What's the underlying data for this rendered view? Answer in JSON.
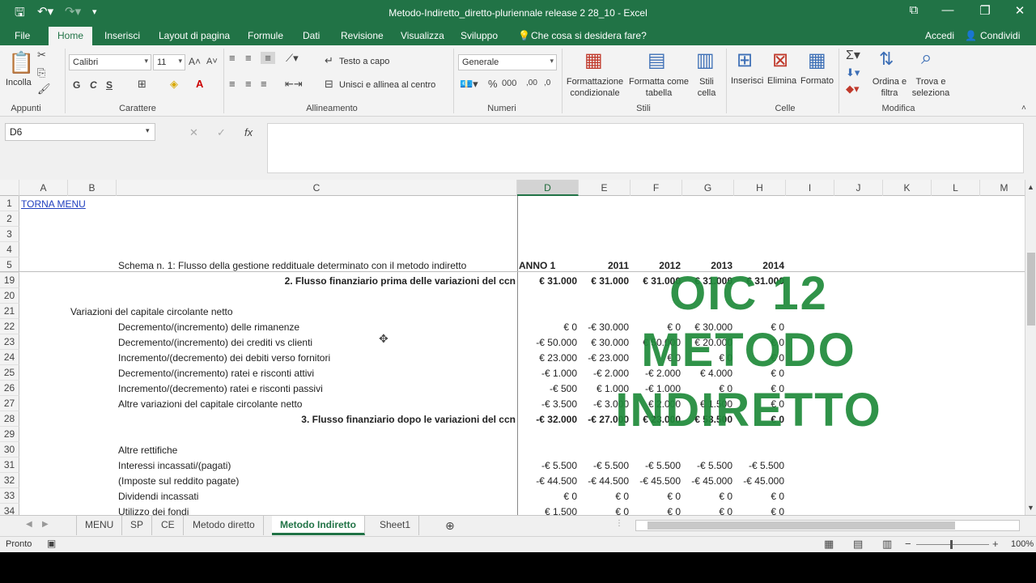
{
  "window": {
    "title": "Metodo-Indiretto_diretto-pluriennale release 2 28_10 - Excel"
  },
  "ribbon_tabs": [
    "File",
    "Home",
    "Inserisci",
    "Layout di pagina",
    "Formule",
    "Dati",
    "Revisione",
    "Visualizza",
    "Sviluppo",
    "Che cosa si desidera fare?"
  ],
  "account": {
    "signin": "Accedi",
    "share": "Condividi"
  },
  "ribbon": {
    "paste": "Incolla",
    "font_name": "Calibri",
    "font_size": "11",
    "bold": "G",
    "italic": "C",
    "underline": "S",
    "wrap": "Testo a capo",
    "merge": "Unisci e allinea al centro",
    "number_format": "Generale",
    "cond_format": "Formattazione condizionale",
    "format_table": "Formatta come tabella",
    "cell_styles": "Stili cella",
    "insert": "Inserisci",
    "delete": "Elimina",
    "format": "Formato",
    "sort": "Ordina e filtra",
    "find": "Trova e seleziona",
    "groups": [
      "Appunti",
      "Carattere",
      "Allineamento",
      "Numeri",
      "Stili",
      "Celle",
      "Modifica"
    ]
  },
  "namebox": "D6",
  "columns": [
    "A",
    "B",
    "C",
    "D",
    "E",
    "F",
    "G",
    "H",
    "I",
    "J",
    "K",
    "L",
    "M"
  ],
  "rows": [
    {
      "n": "1",
      "a": "TORNA MENU"
    },
    {
      "n": "2"
    },
    {
      "n": "3"
    },
    {
      "n": "4"
    },
    {
      "n": "5",
      "c": "Schema n. 1: Flusso della gestione reddituale determinato con il metodo indiretto",
      "vals": [
        "ANNO 1",
        "2011",
        "2012",
        "2013",
        "2014"
      ],
      "bold": true
    },
    {
      "n": "19",
      "cr": "2. Flusso finanziario prima delle variazioni del ccn",
      "vals": [
        "€ 31.000",
        "€ 31.000",
        "€ 31.000",
        "€ 31.000",
        "€ 31.000"
      ],
      "bold": true
    },
    {
      "n": "20"
    },
    {
      "n": "21",
      "b": "Variazioni del capitale circolante netto"
    },
    {
      "n": "22",
      "c": "Decremento/(incremento) delle rimanenze",
      "vals": [
        "€ 0",
        "-€ 30.000",
        "€ 0",
        "€ 30.000",
        "€ 0"
      ]
    },
    {
      "n": "23",
      "c": "Decremento/(incremento) dei crediti vs clienti",
      "vals": [
        "-€ 50.000",
        "€ 30.000",
        "€ 50.000",
        "€ 20.000",
        "€ 0"
      ]
    },
    {
      "n": "24",
      "c": "Incremento/(decremento) dei debiti verso fornitori",
      "vals": [
        "€ 23.000",
        "-€ 23.000",
        "€ 0",
        "€ 0",
        "€ 0"
      ]
    },
    {
      "n": "25",
      "c": "Decremento/(incremento) ratei e risconti attivi",
      "vals": [
        "-€ 1.000",
        "-€ 2.000",
        "-€ 2.000",
        "€ 4.000",
        "€ 0"
      ]
    },
    {
      "n": "26",
      "c": "Incremento/(decremento) ratei e risconti passivi",
      "vals": [
        "-€ 500",
        "€ 1.000",
        "-€ 1.000",
        "€ 0",
        "€ 0"
      ]
    },
    {
      "n": "27",
      "c": "Altre variazioni del capitale circolante netto",
      "vals": [
        "-€ 3.500",
        "-€ 3.000",
        "€ 2.000",
        "€ 1.500",
        "€ 0"
      ]
    },
    {
      "n": "28",
      "cr": "3. Flusso finanziario dopo le variazioni del ccn",
      "vals": [
        "-€ 32.000",
        "-€ 27.000",
        "€ 23.000",
        "€ 53.500",
        "€ 0"
      ],
      "bold": true
    },
    {
      "n": "29"
    },
    {
      "n": "30",
      "c": "Altre rettifiche"
    },
    {
      "n": "31",
      "c": "Interessi incassati/(pagati)",
      "vals": [
        "-€ 5.500",
        "-€ 5.500",
        "-€ 5.500",
        "-€ 5.500",
        "-€ 5.500"
      ]
    },
    {
      "n": "32",
      "c": "(Imposte sul reddito pagate)",
      "vals": [
        "-€ 44.500",
        "-€ 44.500",
        "-€ 45.500",
        "-€ 45.000",
        "-€ 45.000"
      ]
    },
    {
      "n": "33",
      "c": "Dividendi incassati",
      "vals": [
        "€ 0",
        "€ 0",
        "€ 0",
        "€ 0",
        "€ 0"
      ]
    },
    {
      "n": "34",
      "c": "Utilizzo dei fondi",
      "vals": [
        "€ 1.500",
        "€ 0",
        "€ 0",
        "€ 0",
        "€ 0"
      ]
    }
  ],
  "overlay": {
    "line1": "OIC 12",
    "line2": "METODO",
    "line3": "INDIRETTO",
    "color": "#1f8a3a"
  },
  "sheets": [
    "MENU",
    "SP",
    "CE",
    "Metodo diretto",
    "Metodo Indiretto",
    "Sheet1"
  ],
  "active_sheet": "Metodo Indiretto",
  "status": {
    "ready": "Pronto",
    "zoom": "100%"
  }
}
